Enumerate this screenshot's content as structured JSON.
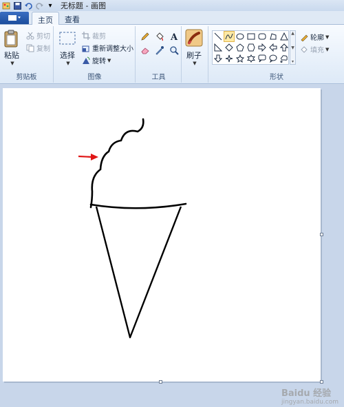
{
  "window": {
    "title": "无标题 - 画图"
  },
  "tabs": {
    "home": "主页",
    "view": "查看"
  },
  "clipboard": {
    "paste": "粘贴",
    "cut": "剪切",
    "copy": "复制",
    "group": "剪贴板"
  },
  "image": {
    "select": "选择",
    "crop": "裁剪",
    "resize": "重新调整大小",
    "rotate": "旋转",
    "group": "图像"
  },
  "tools": {
    "group": "工具"
  },
  "brushes": {
    "label": "刷子"
  },
  "shapes": {
    "outline": "轮廓",
    "fill": "填充",
    "group": "形状"
  },
  "watermark": {
    "text": "Baidu 经验",
    "url": "jingyan.baidu.com"
  },
  "colors": {
    "accent": "#2b5797",
    "arrow": "#e01515",
    "stroke": "#000000"
  }
}
